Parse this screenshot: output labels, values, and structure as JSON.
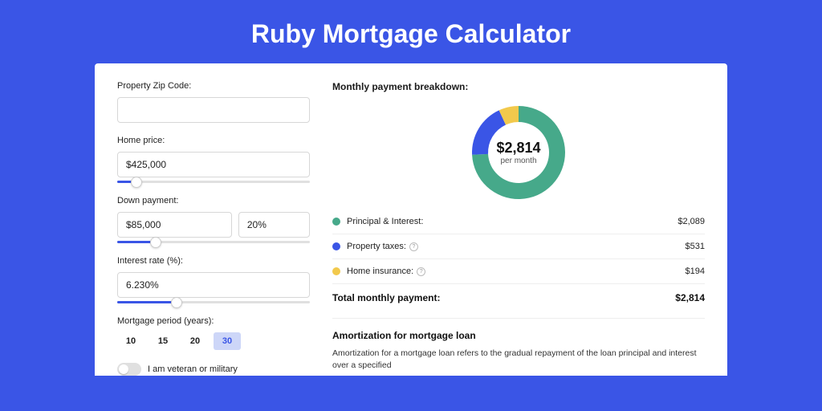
{
  "title": "Ruby Mortgage Calculator",
  "form": {
    "zip_label": "Property Zip Code:",
    "zip_value": "",
    "home_price_label": "Home price:",
    "home_price_value": "$425,000",
    "down_payment_label": "Down payment:",
    "down_payment_amount": "$85,000",
    "down_payment_percent": "20%",
    "interest_label": "Interest rate (%):",
    "interest_value": "6.230%",
    "period_label": "Mortgage period (years):",
    "periods": [
      "10",
      "15",
      "20",
      "30"
    ],
    "active_period": "30",
    "veteran_label": "I am veteran or military"
  },
  "breakdown": {
    "title": "Monthly payment breakdown:",
    "donut_amount": "$2,814",
    "donut_sub": "per month",
    "items": [
      {
        "label": "Principal & Interest:",
        "value": "$2,089",
        "color": "#46a98a",
        "info": false
      },
      {
        "label": "Property taxes:",
        "value": "$531",
        "color": "#3a55e6",
        "info": true
      },
      {
        "label": "Home insurance:",
        "value": "$194",
        "color": "#f2c94c",
        "info": true
      }
    ],
    "total_label": "Total monthly payment:",
    "total_value": "$2,814"
  },
  "amortization": {
    "title": "Amortization for mortgage loan",
    "text": "Amortization for a mortgage loan refers to the gradual repayment of the loan principal and interest over a specified"
  },
  "chart_data": {
    "type": "pie",
    "title": "Monthly payment breakdown",
    "series": [
      {
        "name": "Principal & Interest",
        "value": 2089,
        "color": "#46a98a"
      },
      {
        "name": "Property taxes",
        "value": 531,
        "color": "#3a55e6"
      },
      {
        "name": "Home insurance",
        "value": 194,
        "color": "#f2c94c"
      }
    ],
    "total": 2814,
    "center_label": "$2,814 per month"
  }
}
